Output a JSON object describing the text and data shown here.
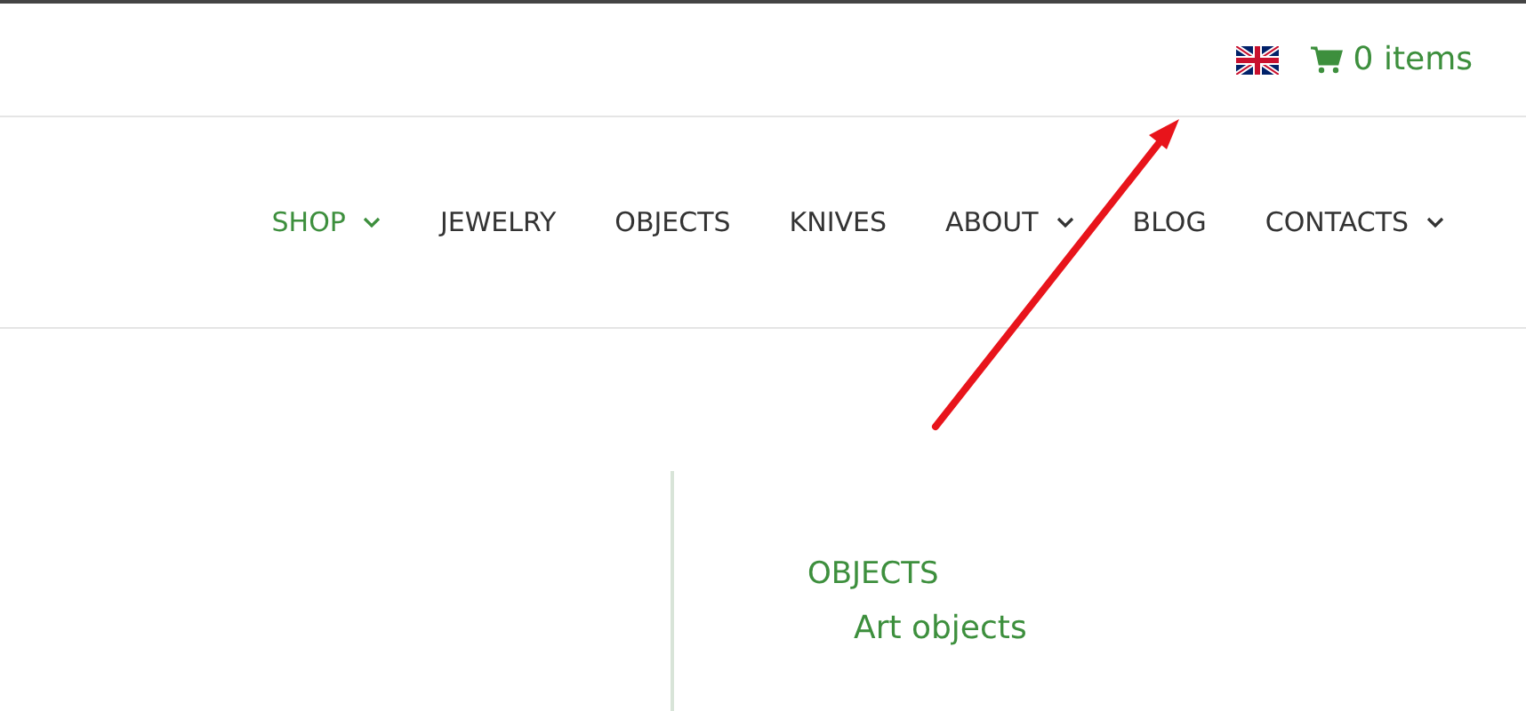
{
  "topbar": {
    "cart": "0 items"
  },
  "nav": [
    {
      "label": "SHOP",
      "selected": true,
      "dropdown": true
    },
    {
      "label": "JEWELRY",
      "selected": false,
      "dropdown": false
    },
    {
      "label": "OBJECTS",
      "selected": false,
      "dropdown": false
    },
    {
      "label": "KNIVES",
      "selected": false,
      "dropdown": false
    },
    {
      "label": "ABOUT",
      "selected": false,
      "dropdown": true
    },
    {
      "label": "BLOG",
      "selected": false,
      "dropdown": false
    },
    {
      "label": "CONTACTS",
      "selected": false,
      "dropdown": true
    }
  ],
  "categories": [
    {
      "label": "OBJECTS",
      "children": [
        {
          "label": "Art objects"
        }
      ]
    }
  ]
}
